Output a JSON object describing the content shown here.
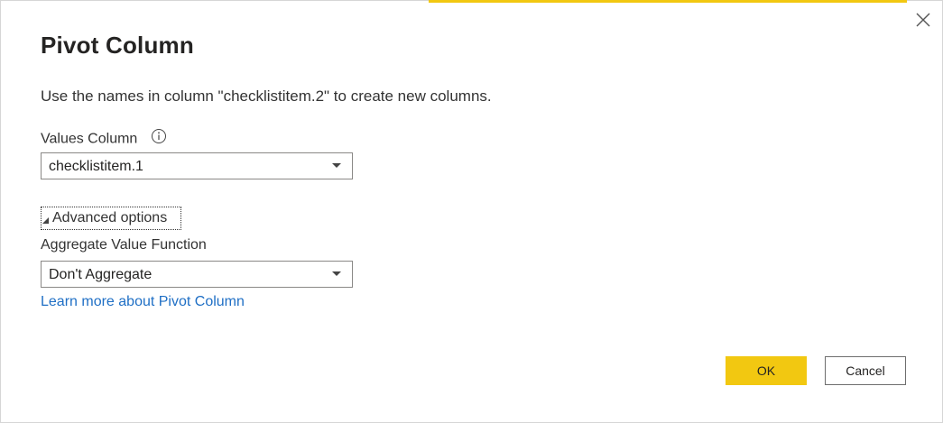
{
  "dialog": {
    "title": "Pivot Column",
    "description": "Use the names in column \"checklistitem.2\" to create new columns.",
    "values_column": {
      "label": "Values Column",
      "info_icon": "info-icon",
      "selected": "checklistitem.1"
    },
    "advanced_options_label": "Advanced options",
    "aggregate_function": {
      "label": "Aggregate Value Function",
      "selected": "Don't Aggregate"
    },
    "learn_more_link": "Learn more about Pivot Column",
    "buttons": {
      "ok": "OK",
      "cancel": "Cancel"
    },
    "close_icon": "close-icon"
  },
  "colors": {
    "accent": "#f2c811",
    "link": "#1f6fc5"
  }
}
